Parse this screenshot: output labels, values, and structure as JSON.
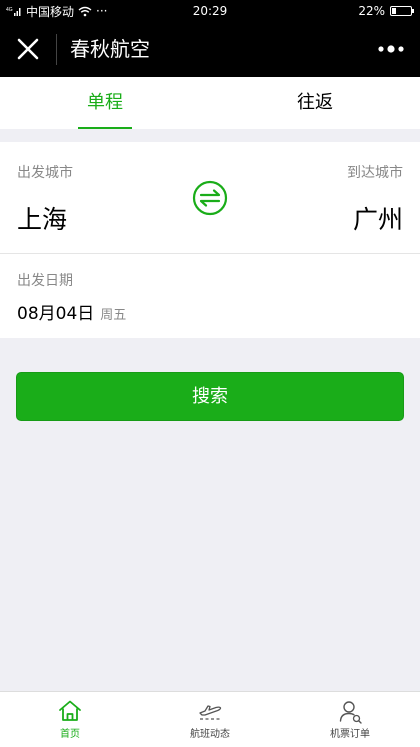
{
  "status_bar": {
    "carrier": "中国移动",
    "more": "···",
    "time": "20:29",
    "battery": "22%",
    "battery_level": 22
  },
  "nav": {
    "title": "春秋航空"
  },
  "tabs": [
    {
      "label": "单程",
      "active": true
    },
    {
      "label": "往返",
      "active": false
    }
  ],
  "form": {
    "departure_label": "出发城市",
    "departure_city": "上海",
    "arrival_label": "到达城市",
    "arrival_city": "广州",
    "date_label": "出发日期",
    "date_value": "08月04日",
    "weekday": "周五"
  },
  "search_button": "搜索",
  "bottom_tabs": [
    {
      "label": "首页",
      "icon": "home-icon",
      "active": true
    },
    {
      "label": "航班动态",
      "icon": "plane-icon",
      "active": false
    },
    {
      "label": "机票订单",
      "icon": "user-icon",
      "active": false
    }
  ],
  "colors": {
    "accent": "#1aad19",
    "navbar": "#000000",
    "background": "#efeff4"
  }
}
